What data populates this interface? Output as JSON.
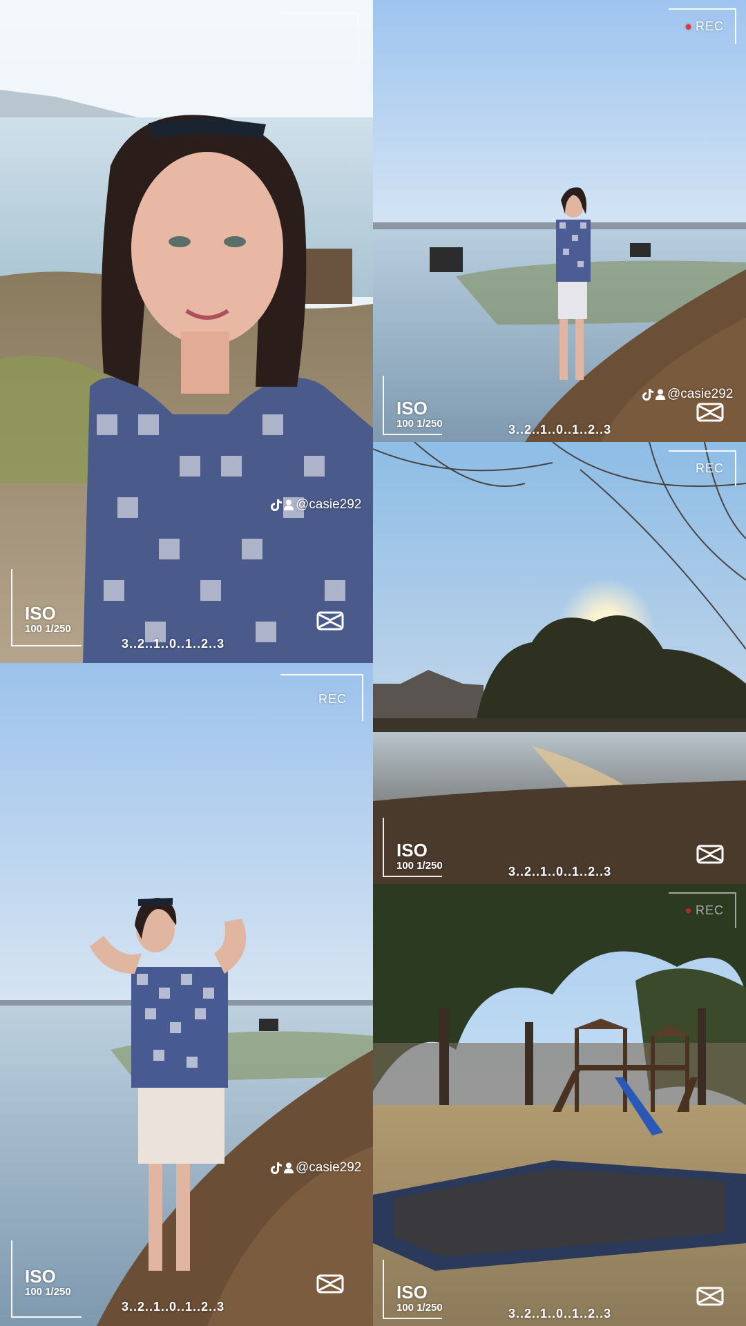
{
  "overlay": {
    "rec_label": "REC",
    "iso_label": "ISO",
    "iso_values": "100 1/250",
    "exposure_scale": "3..2..1..0..1..2..3",
    "watermark_handle": "@casie292",
    "watermark_icons": [
      "tiktok-icon",
      "user-icon"
    ],
    "editor_logo": "capcut-icon",
    "rec_dot_color": "#ff2b2b"
  },
  "panels": [
    {
      "id": "selfie",
      "scene": "woman in checked shirt smiling at lakeshore"
    },
    {
      "id": "lake-standing",
      "scene": "woman standing at flooded lake shore"
    },
    {
      "id": "sunset-pond",
      "scene": "sun through trees over pond"
    },
    {
      "id": "lake-posing",
      "scene": "woman posing with hands on head by lake"
    },
    {
      "id": "playground",
      "scene": "garden with wooden jungle gym, slide and trampoline"
    }
  ]
}
